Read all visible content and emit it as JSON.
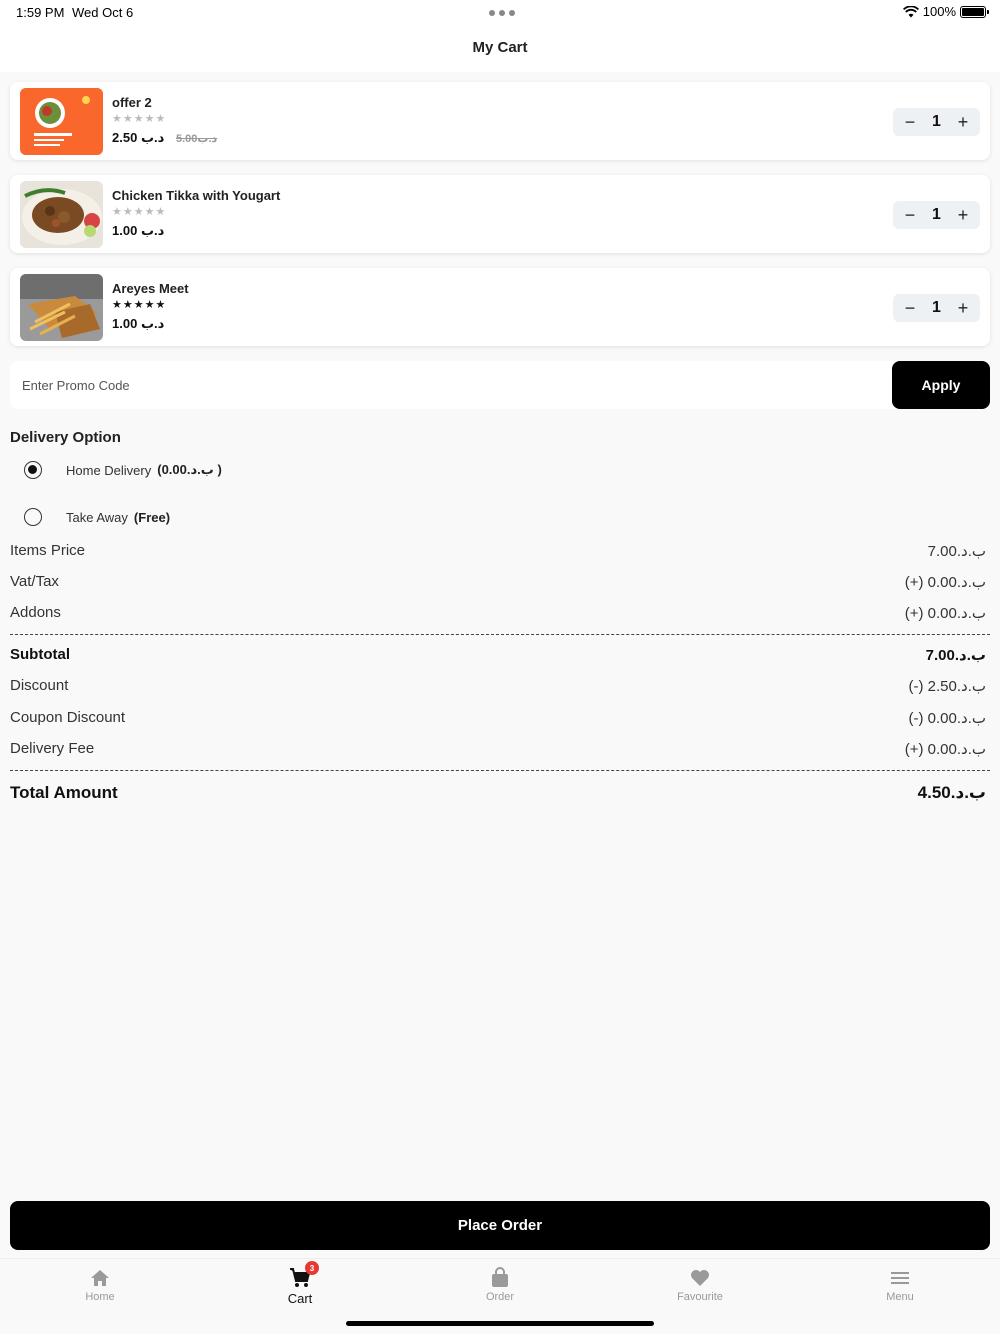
{
  "status_bar": {
    "time": "1:59 PM",
    "date": "Wed Oct 6",
    "battery": "100%"
  },
  "header": {
    "title": "My Cart"
  },
  "cart_items": [
    {
      "name": "offer 2",
      "rating": 0,
      "price": "2.50",
      "currency": "د.ب",
      "old_price": "5.00",
      "old_currency": "د.ب",
      "qty": "1"
    },
    {
      "name": "Chicken Tikka with Yougart",
      "rating": 0,
      "price": "1.00",
      "currency": "د.ب",
      "qty": "1"
    },
    {
      "name": "Areyes Meet",
      "rating": 5,
      "price": "1.00",
      "currency": "د.ب",
      "qty": "1"
    }
  ],
  "promo": {
    "placeholder": "Enter Promo Code",
    "apply_label": "Apply"
  },
  "delivery": {
    "title": "Delivery Option",
    "options": [
      {
        "label": "Home Delivery",
        "extra": "(0.00.ب.د )",
        "selected": true
      },
      {
        "label": "Take Away",
        "extra": "(Free)",
        "selected": false
      }
    ]
  },
  "summary": {
    "items_price_label": "Items Price",
    "items_price": "7.00.ب.د",
    "vat_label": "Vat/Tax",
    "vat": "(+) 0.00.ب.د",
    "addons_label": "Addons",
    "addons": "(+) 0.00.ب.د",
    "subtotal_label": "Subtotal",
    "subtotal": "7.00.ب.د",
    "discount_label": "Discount",
    "discount": "(-) 2.50.ب.د",
    "coupon_label": "Coupon Discount",
    "coupon": "(-) 0.00.ب.د",
    "delivery_fee_label": "Delivery Fee",
    "delivery_fee": "(+) 0.00.ب.د",
    "total_label": "Total Amount",
    "total": "4.50.ب.د"
  },
  "place_order_label": "Place Order",
  "nav": {
    "home": "Home",
    "cart": "Cart",
    "cart_badge": "3",
    "order": "Order",
    "favourite": "Favourite",
    "menu": "Menu"
  },
  "colors": {
    "primary": "#000000",
    "badge": "#e53935",
    "background": "#f9f9f9"
  }
}
